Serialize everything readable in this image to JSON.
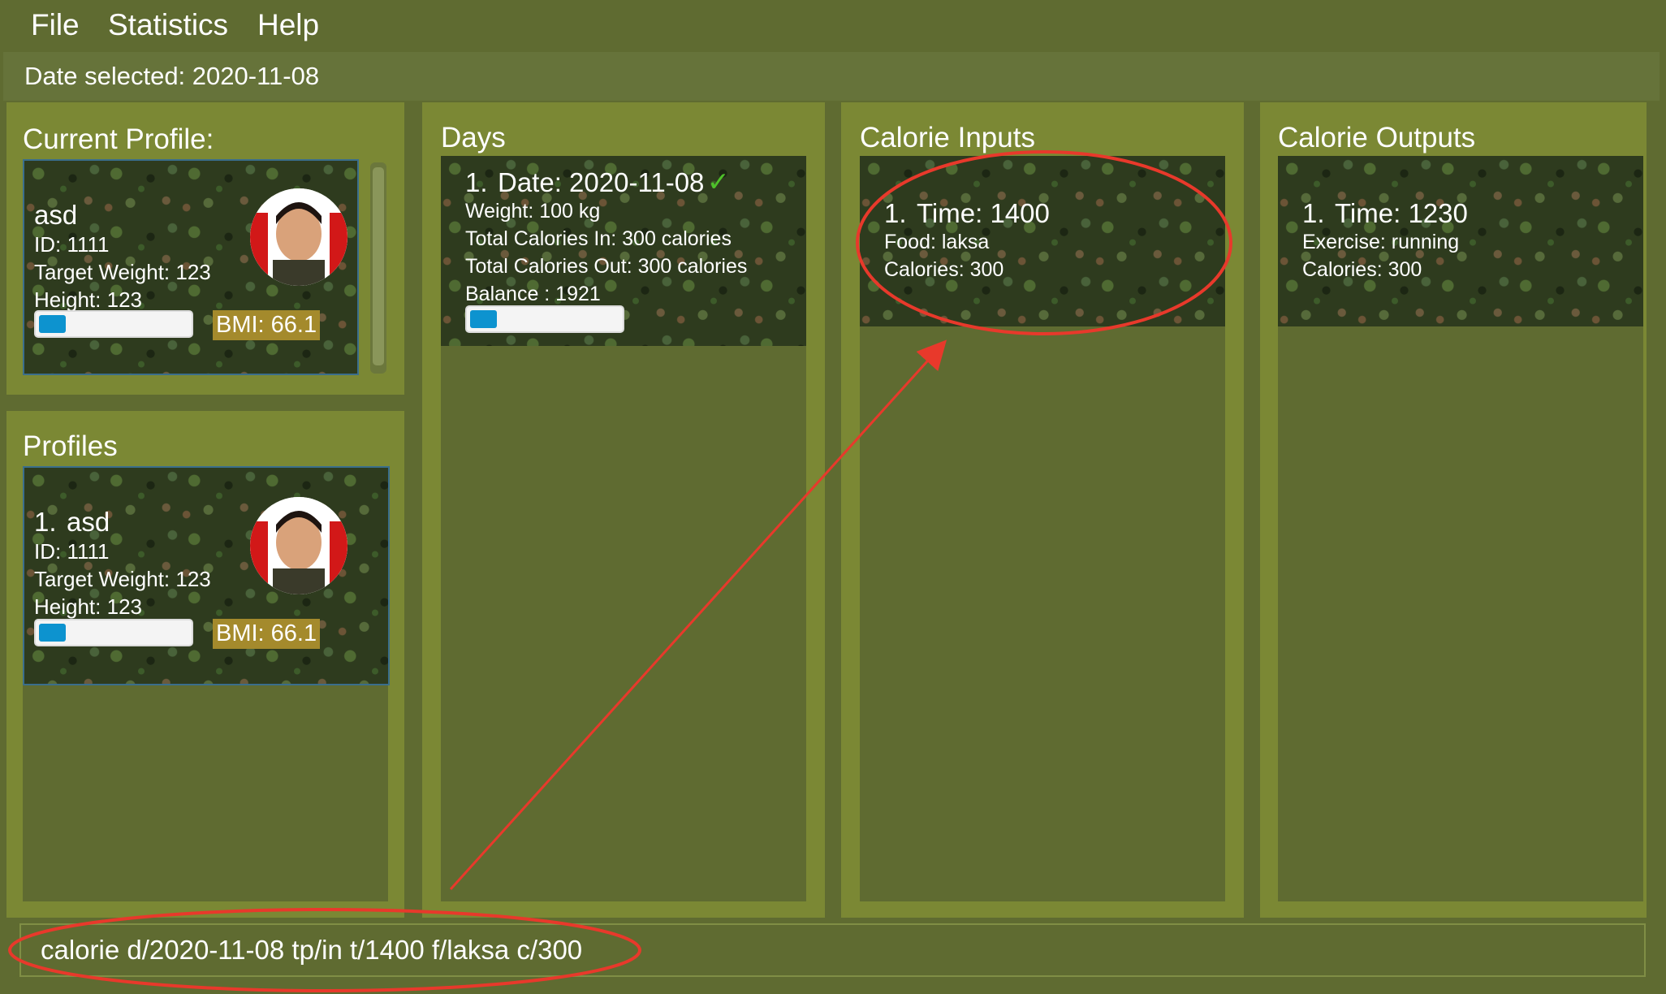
{
  "menu": {
    "file": "File",
    "statistics": "Statistics",
    "help": "Help"
  },
  "date_bar": {
    "label": "Date selected: 2020-11-08"
  },
  "current_profile": {
    "title": "Current Profile:",
    "name": "asd",
    "id": "ID: 1111",
    "target_weight": "Target Weight: 123",
    "height": "Height: 123",
    "bmi": "BMI: 66.1",
    "progress_fraction": 0.18
  },
  "profiles": {
    "title": "Profiles",
    "items": [
      {
        "index": "1.",
        "name": "asd",
        "id": "ID: 1111",
        "target_weight": "Target Weight: 123",
        "height": "Height: 123",
        "bmi": "BMI: 66.1",
        "progress_fraction": 0.18
      }
    ]
  },
  "days": {
    "title": "Days",
    "items": [
      {
        "index": "1.",
        "date": "Date: 2020-11-08",
        "check": "✓",
        "weight": "Weight: 100 kg",
        "calories_in": "Total Calories In: 300 calories",
        "calories_out": "Total Calories Out: 300 calories",
        "balance": "Balance : 1921",
        "progress_fraction": 0.18
      }
    ]
  },
  "calorie_inputs": {
    "title": "Calorie Inputs",
    "items": [
      {
        "index": "1.",
        "time": "Time: 1400",
        "detail": "Food: laksa",
        "calories": "Calories: 300"
      }
    ]
  },
  "calorie_outputs": {
    "title": "Calorie Outputs",
    "items": [
      {
        "index": "1.",
        "time": "Time: 1230",
        "detail": "Exercise: running",
        "calories": "Calories: 300"
      }
    ]
  },
  "command_box": {
    "value": "calorie d/2020-11-08 tp/in t/1400 f/laksa c/300"
  },
  "colors": {
    "accent": "#0d93cf",
    "panel": "#7b8834",
    "background": "#5f6b31",
    "annotation": "#e8392b",
    "bmi_badge": "#a48a2c"
  },
  "icons": [
    "check-icon",
    "avatar-photo"
  ]
}
